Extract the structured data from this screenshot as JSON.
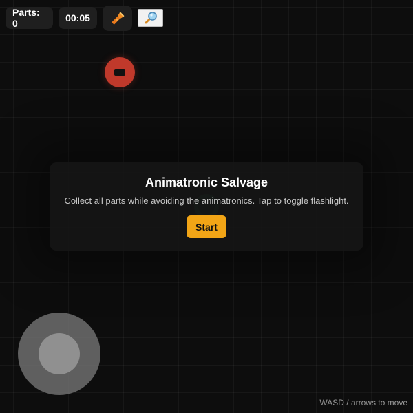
{
  "hud": {
    "parts_label": "Parts: 0",
    "timer": "00:05",
    "flashlight_icon": "flashlight-icon",
    "inspect_icon": "magnifier-icon"
  },
  "panel": {
    "title": "Animatronic Salvage",
    "description": "Collect all parts while avoiding the animatronics. Tap to toggle flashlight.",
    "start_label": "Start"
  },
  "hint": "WASD / arrows to move",
  "colors": {
    "background": "#0d0d0d",
    "animatronic": "#c0392b",
    "player_ring": "#1d5a2f",
    "start_button": "#f2a516",
    "hud_pill": "#1f1f1f",
    "joystick_base": "#6e6e6e",
    "joystick_knob": "#969696"
  }
}
